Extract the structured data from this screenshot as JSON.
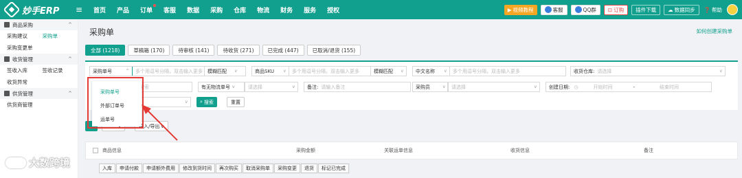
{
  "app": {
    "name": "妙手ERP"
  },
  "nav": [
    "首页",
    "产品",
    "订单",
    "客服",
    "数据",
    "采购",
    "仓库",
    "物流",
    "财务",
    "服务",
    "授权"
  ],
  "topbar_right": {
    "video": "视频教程",
    "service": "客服",
    "qq": "QQ群",
    "order": "订购",
    "plugin": "插件下载",
    "sync": "数据同步",
    "help": "帮助"
  },
  "sidebar": {
    "group1": "商品采购",
    "g1_items": [
      "采购建议",
      "采购单",
      "采购变更单"
    ],
    "group2": "收货管理",
    "g2_items": [
      "签收入库",
      "签收记录",
      "收货异常"
    ],
    "group3": "供货管理",
    "g3_items": [
      "供货商管理"
    ]
  },
  "page": {
    "title": "采购单",
    "help_link": "如何创建采购单"
  },
  "tabs": [
    "全部 (1218)",
    "草稿箱 (170)",
    "待审核 (141)",
    "待收货 (271)",
    "已完成 (447)",
    "已取消/退货 (155)"
  ],
  "filters": {
    "purchase_no_select": "采购单号",
    "multi_ph": "多个用逗号分隔，双击输入更多",
    "fuzzy": "模糊匹配",
    "sku_select": "商品SKU",
    "multi_ph2": "多个用逗号分隔，双击输入更多",
    "fuzzy2": "模糊匹配",
    "cn_name_select": "中文名称",
    "multi_ph3": "多个用逗号分隔，双击输入更多",
    "warehouse_label": "收货仓库:",
    "select_ph": "请选择",
    "search_ph": "搜索",
    "logistics_select": "有无物流单号",
    "select_ph2": "请选择",
    "remark_label": "备注:",
    "remark_ph": "请输入备注",
    "buyer_select": "采购员",
    "select_ph3": "请选择",
    "created_label": "创建日期:",
    "start_ph": "开始时间",
    "dash": "-",
    "end_ph": "结束时间",
    "search_btn": "搜索",
    "reset_btn": "重置"
  },
  "dropdown": [
    "采购单号",
    "外部订单号",
    "运单号"
  ],
  "ops": {
    "create": "",
    "more": "",
    "import_export": "导入/导出"
  },
  "table_headers": [
    "商品信息",
    "采购金额",
    "关联运单信息",
    "收货信息",
    "备注"
  ],
  "actions": [
    "入库",
    "申请付款",
    "申请额外费用",
    "修改到货时间",
    "再次购买",
    "取消采购单",
    "采购变更",
    "退货",
    "标记已完成"
  ],
  "watermark": "大数跨境",
  "colors": {
    "primary": "#12a08e",
    "highlight": "#e53935"
  }
}
